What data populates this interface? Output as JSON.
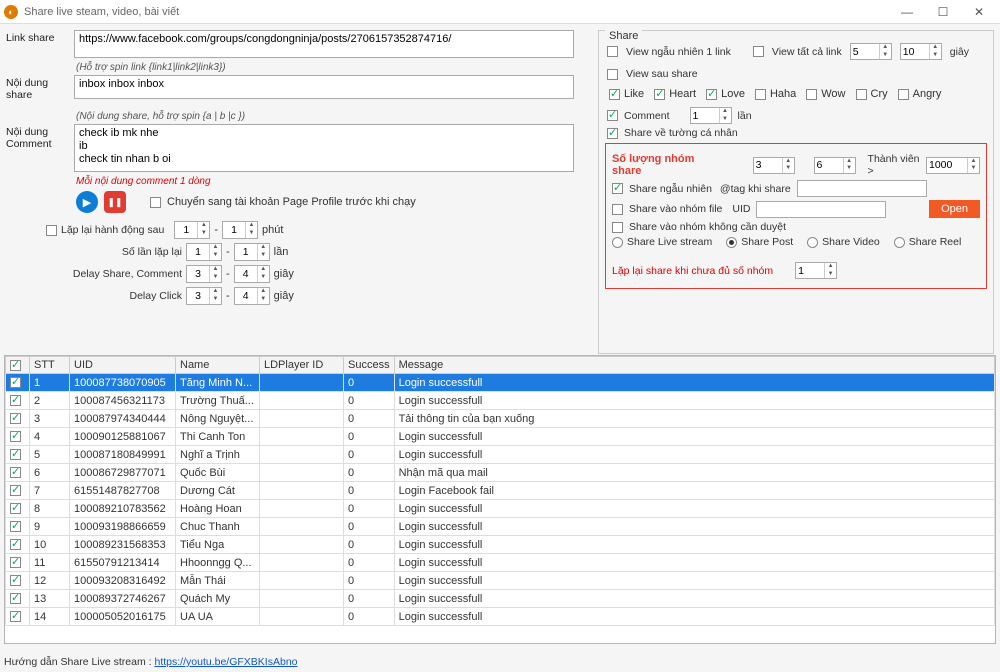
{
  "window": {
    "title": "Share live steam, video, bài viết"
  },
  "left": {
    "link_share_label": "Link share",
    "url_value": "https://www.facebook.com/groups/congdongninja/posts/2706157352874716/",
    "spin_hint": "(Hỗ trợ spin link {link1|link2|link3})",
    "noi_dung_share_label": "Nội dung share",
    "noi_dung_share_value": "inbox inbox inbox",
    "comment_spin_hint": "(Nội dung share, hỗ trợ spin {a | b |c })",
    "noi_dung_comment_label": "Nội dung Comment",
    "noi_dung_comment_value": "check ib mk nhe\nib\ncheck tin nhan b oi",
    "one_line_hint": "Mỗi nội dung comment 1 dòng",
    "page_profile_label": "Chuyển sang tài khoản Page Profile trước khi chạy",
    "laplai_label": "Lặp lại hành động sau",
    "laplai_from": "1",
    "laplai_to": "1",
    "laplai_unit": "phút",
    "solan_label": "Số lần lặp lại",
    "solan_from": "1",
    "solan_to": "1",
    "solan_unit": "lần",
    "delay_share_label": "Delay Share, Comment",
    "delay_share_from": "3",
    "delay_share_to": "4",
    "delay_share_unit": "giây",
    "delay_click_label": "Delay Click",
    "delay_click_from": "3",
    "delay_click_to": "4",
    "delay_click_unit": "giây"
  },
  "right": {
    "group_title": "Share",
    "view_random_label": "View ngẫu nhiên 1 link",
    "view_all_label": "View tất cả link",
    "view_from": "5",
    "view_to": "10",
    "view_unit": "giây",
    "view_after_share_label": "View sau share",
    "like_label": "Like",
    "heart_label": "Heart",
    "love_label": "Love",
    "haha_label": "Haha",
    "wow_label": "Wow",
    "cry_label": "Cry",
    "angry_label": "Angry",
    "comment_label": "Comment",
    "comment_count": "1",
    "comment_unit": "lần",
    "share_wall_label": "Share về tường cá nhân",
    "group_box_title": "Số lượng nhóm share",
    "group_from": "3",
    "group_to": "6",
    "thanh_vien_label": "Thành viên >",
    "thanh_vien_value": "1000",
    "share_random_label": "Share ngẫu nhiên",
    "tag_label": "@tag khi share",
    "share_file_label": "Share vào nhóm file",
    "uid_label": "UID",
    "open_label": "Open",
    "share_no_approve_label": "Share vào nhóm không cần duyệt",
    "share_live_label": "Share Live stream",
    "share_post_label": "Share Post",
    "share_video_label": "Share Video",
    "share_reel_label": "Share Reel",
    "repeat_red_label": "Lặp lại share khi chưa đủ số nhóm",
    "repeat_red_value": "1"
  },
  "table": {
    "headers": {
      "stt": "STT",
      "uid": "UID",
      "name": "Name",
      "ld": "LDPlayer ID",
      "success": "Success",
      "message": "Message"
    },
    "rows": [
      {
        "stt": "1",
        "uid": "100087738070905",
        "name": "Tăng Minh N...",
        "ld": "",
        "success": "0",
        "message": "Login successfull",
        "selected": true
      },
      {
        "stt": "2",
        "uid": "100087456321173",
        "name": "Trường Thuấ...",
        "ld": "",
        "success": "0",
        "message": "Login successfull"
      },
      {
        "stt": "3",
        "uid": "100087974340444",
        "name": "Nông Nguyệt...",
        "ld": "",
        "success": "0",
        "message": "Tải thông tin của bạn xuống"
      },
      {
        "stt": "4",
        "uid": "100090125881067",
        "name": "Thi Canh Ton",
        "ld": "",
        "success": "0",
        "message": "Login successfull"
      },
      {
        "stt": "5",
        "uid": "100087180849991",
        "name": "Nghĩ a Trịnh",
        "ld": "",
        "success": "0",
        "message": "Login successfull"
      },
      {
        "stt": "6",
        "uid": "100086729877071",
        "name": "Quốc Bùi",
        "ld": "",
        "success": "0",
        "message": "Nhận mã qua mail"
      },
      {
        "stt": "7",
        "uid": "61551487827708",
        "name": "Dương Cát",
        "ld": "",
        "success": "0",
        "message": "Login Facebook fail"
      },
      {
        "stt": "8",
        "uid": "100089210783562",
        "name": "Hoàng Hoan",
        "ld": "",
        "success": "0",
        "message": "Login successfull"
      },
      {
        "stt": "9",
        "uid": "100093198866659",
        "name": "Chuc Thanh",
        "ld": "",
        "success": "0",
        "message": "Login successfull"
      },
      {
        "stt": "10",
        "uid": "100089231568353",
        "name": "Tiểu Nga",
        "ld": "",
        "success": "0",
        "message": "Login successfull"
      },
      {
        "stt": "11",
        "uid": "61550791213414",
        "name": "Hhoonngg Q...",
        "ld": "",
        "success": "0",
        "message": "Login successfull"
      },
      {
        "stt": "12",
        "uid": "100093208316492",
        "name": "Mẫn Thái",
        "ld": "",
        "success": "0",
        "message": "Login successfull"
      },
      {
        "stt": "13",
        "uid": "100089372746267",
        "name": "Quách My",
        "ld": "",
        "success": "0",
        "message": "Login successfull"
      },
      {
        "stt": "14",
        "uid": "100005052016175",
        "name": "UA UA",
        "ld": "",
        "success": "0",
        "message": "Login successfull"
      }
    ]
  },
  "footer": {
    "label": "Hướng dẫn Share Live stream :",
    "link_text": "https://youtu.be/GFXBKIsAbno"
  }
}
